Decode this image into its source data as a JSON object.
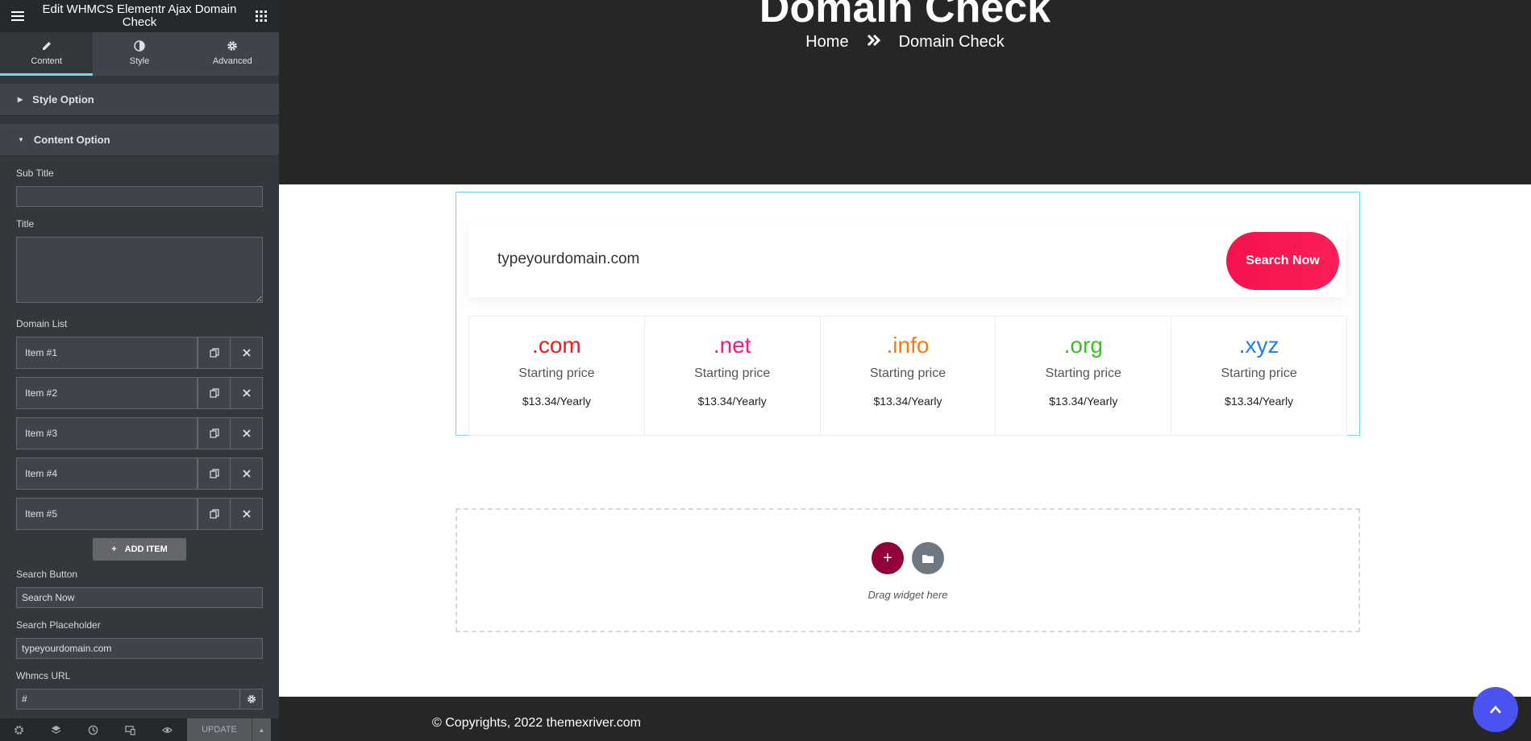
{
  "panel": {
    "title": "Edit WHMCS Elementr Ajax Domain Check",
    "tabs": [
      {
        "label": "Content",
        "icon": "pencil-icon"
      },
      {
        "label": "Style",
        "icon": "contrast-icon"
      },
      {
        "label": "Advanced",
        "icon": "gear-icon"
      }
    ],
    "sections": {
      "style_option": "Style Option",
      "content_option": "Content Option"
    },
    "fields": {
      "sub_title_label": "Sub Title",
      "sub_title_value": "",
      "title_label": "Title",
      "title_value": "",
      "domain_list_label": "Domain List",
      "items": [
        "Item #1",
        "Item #2",
        "Item #3",
        "Item #4",
        "Item #5"
      ],
      "add_item": "ADD ITEM",
      "search_button_label": "Search Button",
      "search_button_value": "Search Now",
      "search_placeholder_label": "Search Placeholder",
      "search_placeholder_value": "typeyourdomain.com",
      "whmcs_url_label": "Whmcs URL",
      "whmcs_url_value": "#"
    },
    "footer": {
      "update": "UPDATE"
    }
  },
  "hero": {
    "title": "Domain Check",
    "breadcrumb": {
      "home": "Home",
      "current": "Domain Check"
    }
  },
  "search": {
    "placeholder": "typeyourdomain.com",
    "button": "Search Now"
  },
  "domains": [
    {
      "ext": ".com",
      "label": "Starting price",
      "price": "$13.34/Yearly",
      "color": "#f01b1b"
    },
    {
      "ext": ".net",
      "label": "Starting price",
      "price": "$13.34/Yearly",
      "color": "#ec1c8a"
    },
    {
      "ext": ".info",
      "label": "Starting price",
      "price": "$13.34/Yearly",
      "color": "#f57a10"
    },
    {
      "ext": ".org",
      "label": "Starting price",
      "price": "$13.34/Yearly",
      "color": "#37c41c"
    },
    {
      "ext": ".xyz",
      "label": "Starting price",
      "price": "$13.34/Yearly",
      "color": "#1f7ef0"
    }
  ],
  "dropzone": {
    "text": "Drag widget here"
  },
  "footer": {
    "copyright": "© Copyrights, 2022 themexriver.com"
  },
  "colors": {
    "accent": "#71d7f7",
    "search_button": "#f5124e",
    "to_top": "#4a52f0"
  }
}
